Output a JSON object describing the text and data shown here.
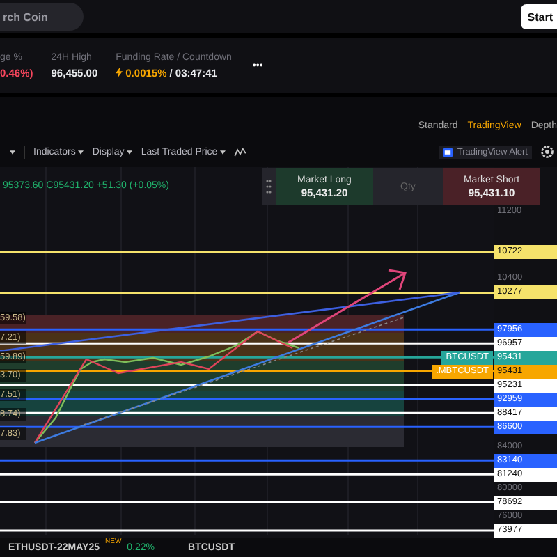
{
  "search": {
    "placeholder": "rch Coin"
  },
  "start_button": "Start",
  "stats": [
    {
      "label": "ge %",
      "value": "0.46%)",
      "color": "#f6465d"
    },
    {
      "label": "24H High",
      "value": "96,455.00",
      "color": "#eaecef"
    },
    {
      "label": "Funding Rate / Countdown",
      "rate": "0.0015%",
      "value": "/ 03:47:41",
      "color": "#eaecef"
    }
  ],
  "more": "•••",
  "view_tabs": [
    {
      "label": "Standard",
      "selected": false
    },
    {
      "label": "TradingView",
      "selected": true
    },
    {
      "label": "Depth",
      "selected": false
    }
  ],
  "toolbar": [
    "Indicators",
    "Display",
    "Last Traded Price"
  ],
  "alert": "TradingView Alert",
  "order_panel": {
    "long_label": "Market Long",
    "long_price": "95,431.20",
    "qty": "Qty",
    "short_label": "Market Short",
    "short_price": "95,431.10"
  },
  "ohlc": "95373.60 C95431.20 +51.30 (+0.05%)",
  "price_levels": [
    {
      "price": "11200",
      "kind": "tick"
    },
    {
      "price": "10722",
      "kind": "line",
      "color": "#f5e26b"
    },
    {
      "price": "10400",
      "kind": "tick"
    },
    {
      "price": "10277",
      "kind": "line",
      "color": "#f5e26b"
    },
    {
      "price": "97956",
      "kind": "line",
      "color": "#2962ff"
    },
    {
      "price": "96957",
      "kind": "line",
      "color": "#ffffff"
    },
    {
      "price": "95431",
      "kind": "line",
      "color": "#26a69a",
      "tag": "BTCUSDT"
    },
    {
      "price": "95431",
      "kind": "line",
      "color": "#f7a600",
      "tag": ".MBTCUSDT"
    },
    {
      "price": "95231",
      "kind": "line",
      "color": "#ffffff"
    },
    {
      "price": "92959",
      "kind": "line",
      "color": "#2962ff"
    },
    {
      "price": "88417",
      "kind": "line",
      "color": "#ffffff"
    },
    {
      "price": "86600",
      "kind": "line",
      "color": "#2962ff"
    },
    {
      "price": "84000",
      "kind": "tick"
    },
    {
      "price": "83140",
      "kind": "line",
      "color": "#2962ff"
    },
    {
      "price": "81240",
      "kind": "line",
      "color": "#ffffff"
    },
    {
      "price": "80000",
      "kind": "tick"
    },
    {
      "price": "78692",
      "kind": "line",
      "color": "#ffffff"
    },
    {
      "price": "76000",
      "kind": "tick"
    },
    {
      "price": "73977",
      "kind": "line",
      "color": "#ffffff"
    }
  ],
  "fib_labels": [
    "59.58)",
    "7.21)",
    "59.89)",
    "3.70)",
    "7.51)",
    "8.74)",
    "7.83)"
  ],
  "tickers": [
    {
      "symbol": "ETHUSDT-22MAY25",
      "badge": "NEW",
      "change": "0.22%",
      "color": "#20b26c"
    },
    {
      "symbol": "BTCUSDT"
    }
  ]
}
